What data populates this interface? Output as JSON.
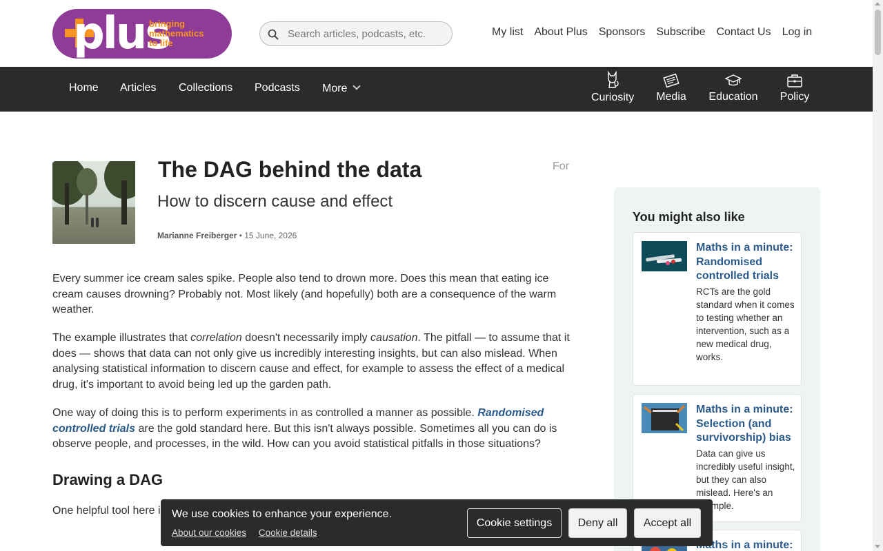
{
  "logo": {
    "word": "plus",
    "tagline": [
      "bringing",
      "mathematics",
      "to life"
    ]
  },
  "search": {
    "placeholder": "Search articles, podcasts, etc."
  },
  "toplinks": [
    "My list",
    "About Plus",
    "Sponsors",
    "Subscribe",
    "Contact Us",
    "Log in"
  ],
  "nav": {
    "links": [
      "Home",
      "Articles",
      "Collections",
      "Podcasts"
    ],
    "more": "More",
    "for_label": "For",
    "audiences": [
      {
        "label": "Curiosity",
        "icon": "cat-icon"
      },
      {
        "label": "Media",
        "icon": "newspaper-icon"
      },
      {
        "label": "Education",
        "icon": "graduation-cap-icon"
      },
      {
        "label": "Policy",
        "icon": "briefcase-icon"
      }
    ]
  },
  "article": {
    "title": "The DAG behind the data",
    "subtitle": "How to discern cause and effect",
    "author": "Marianne Freiberger",
    "date": "• 15 June, 2026",
    "p1": "Every summer ice cream sales spike. People also tend to drown more. Does this mean that eating ice cream causes drowning? Probably not. Most likely (and hopefully) both are a consequence of the warm weather.",
    "p2_a": "The example illustrates that ",
    "p2_em1": "correlation",
    "p2_b": " doesn't necessarily imply ",
    "p2_em2": "causation",
    "p2_c": ". The pitfall — to assume that it does — shows that data can not only give us incredibly interesting insights, but can also mislead. When analysing statistical information to discern cause and effect, for example to assess the effect of a medical drug, it's important to avoid being led up the garden path.",
    "p3_a": "One way of doing this is to perform experiments in as controlled a manner as possible. ",
    "p3_link": "Randomised controlled trials",
    "p3_b": " are the gold standard here. But this isn't always possible. Sometimes all you can do is observe people, and processes, in the wild. How can you avoid statistical pitfalls in those situations?",
    "h2": "Drawing a DAG",
    "p4": "One helpful tool here is a … with statisticians and s… effect from data. A DAG …"
  },
  "sidebar": {
    "title": "You might also like",
    "cards": [
      {
        "title": "Maths in a minute: Randomised controlled trials",
        "desc": "RCTs are the gold standard when it comes to testing whether an intervention, such as a new medical drug, works."
      },
      {
        "title": "Maths in a minute: Selection (and survivorship) bias",
        "desc": "Data can give us incredibly useful insight, but they can also mislead. Here's an example."
      },
      {
        "title": "Maths in a minute:",
        "desc": ""
      }
    ]
  },
  "cookie": {
    "message": "We use cookies to enhance your experience.",
    "link_about": "About our cookies",
    "link_details": "Cookie details",
    "btn_settings": "Cookie settings",
    "btn_deny": "Deny all",
    "btn_accept": "Accept all"
  },
  "colors": {
    "brand_purple": "#8e3c97",
    "brand_orange": "#f7931e",
    "nav_bg": "#2b2b2b",
    "link_blue": "#2a5a8a",
    "sidebar_bg": "#eef3f3"
  }
}
